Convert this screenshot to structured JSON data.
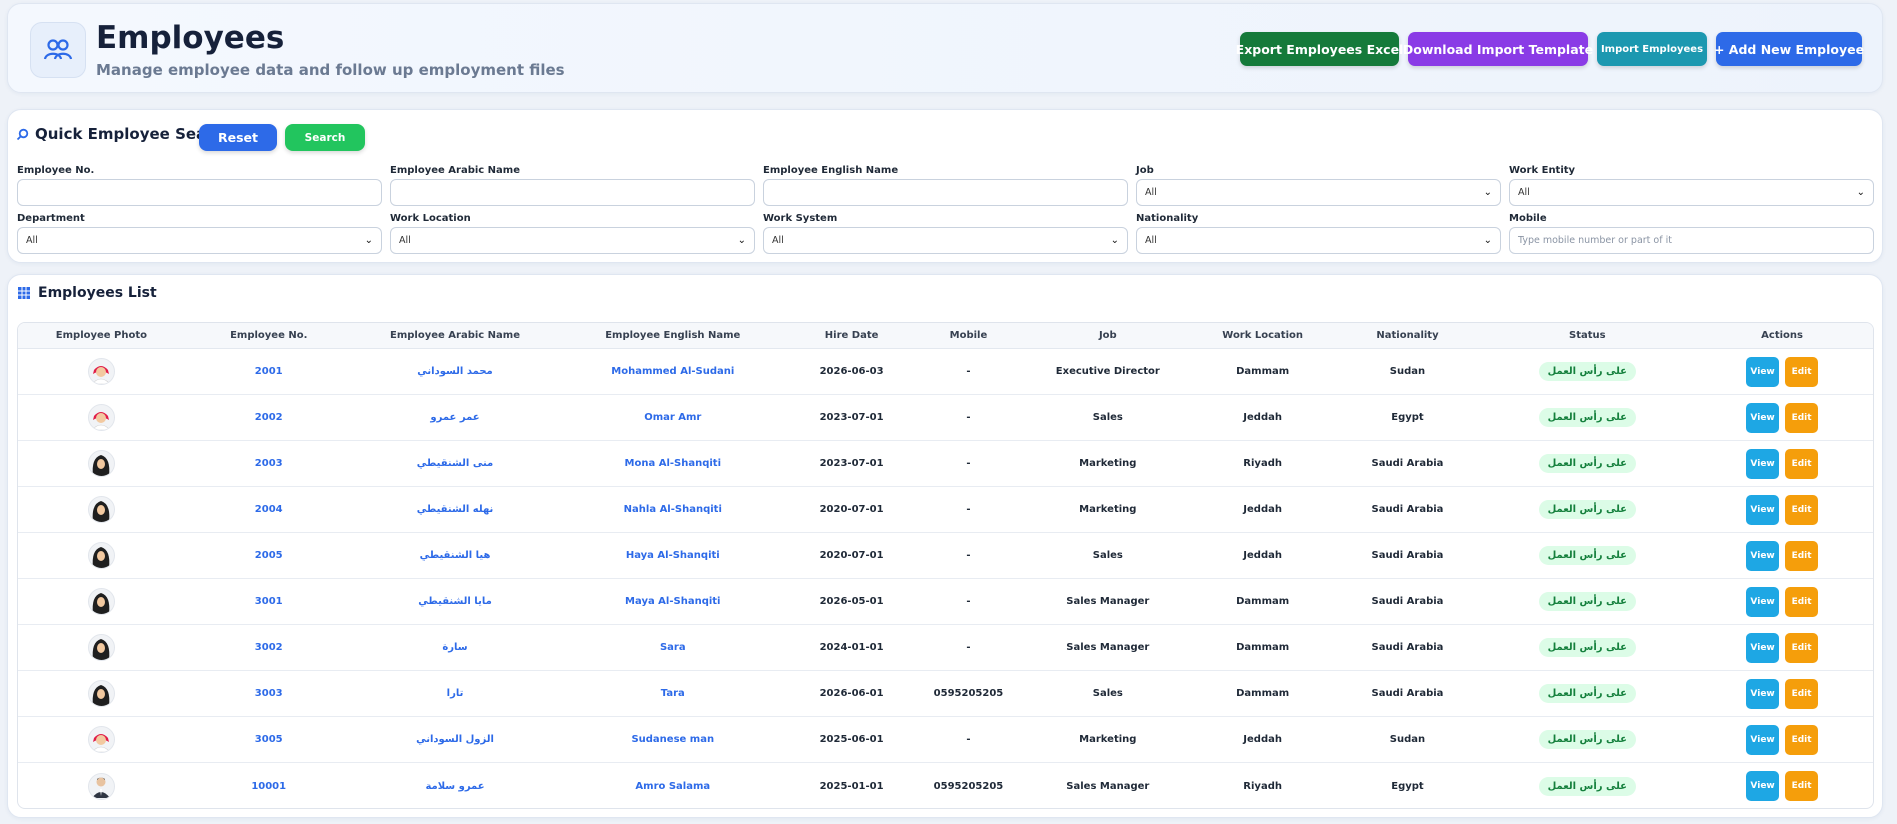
{
  "header": {
    "title": "Employees",
    "subtitle": "Manage employee data and follow up employment files",
    "icon": "users-icon",
    "buttons": {
      "export": "Export Employees Excel",
      "template": "Download Import Template",
      "import": "Import Employees",
      "add": "+ Add New Employee"
    }
  },
  "search": {
    "title": "Quick Employee Search",
    "reset_label": "Reset",
    "search_label": "Search",
    "fields": {
      "employee_no": {
        "label": "Employee No.",
        "value": ""
      },
      "arabic_name": {
        "label": "Employee Arabic Name",
        "value": ""
      },
      "english_name": {
        "label": "Employee English Name",
        "value": ""
      },
      "job": {
        "label": "Job",
        "value": "All"
      },
      "work_entity": {
        "label": "Work Entity",
        "value": "All"
      },
      "department": {
        "label": "Department",
        "value": "All"
      },
      "work_location": {
        "label": "Work Location",
        "value": "All"
      },
      "work_system": {
        "label": "Work System",
        "value": "All"
      },
      "nationality": {
        "label": "Nationality",
        "value": "All"
      },
      "mobile": {
        "label": "Mobile",
        "placeholder": "Type mobile number or part of it"
      }
    }
  },
  "list": {
    "title": "Employees List",
    "columns": [
      "Employee Photo",
      "Employee No.",
      "Employee Arabic Name",
      "Employee English Name",
      "Hire Date",
      "Mobile",
      "Job",
      "Work Location",
      "Nationality",
      "Status",
      "Actions"
    ],
    "view_label": "View",
    "edit_label": "Edit",
    "rows": [
      {
        "photo": "male",
        "no": "2001",
        "ar": "محمد السوداني",
        "en": "Mohammed Al-Sudani",
        "hire": "2026-06-03",
        "mobile": "-",
        "job": "Executive Director",
        "location": "Dammam",
        "nationality": "Sudan",
        "status": "على رأس العمل"
      },
      {
        "photo": "male",
        "no": "2002",
        "ar": "عمر عمرو",
        "en": "Omar Amr",
        "hire": "2023-07-01",
        "mobile": "-",
        "job": "Sales",
        "location": "Jeddah",
        "nationality": "Egypt",
        "status": "على رأس العمل"
      },
      {
        "photo": "female",
        "no": "2003",
        "ar": "منى الشنقيطي",
        "en": "Mona Al-Shanqiti",
        "hire": "2023-07-01",
        "mobile": "-",
        "job": "Marketing",
        "location": "Riyadh",
        "nationality": "Saudi Arabia",
        "status": "على رأس العمل"
      },
      {
        "photo": "female",
        "no": "2004",
        "ar": "نهله الشنقيطي",
        "en": "Nahla Al-Shanqiti",
        "hire": "2020-07-01",
        "mobile": "-",
        "job": "Marketing",
        "location": "Jeddah",
        "nationality": "Saudi Arabia",
        "status": "على رأس العمل"
      },
      {
        "photo": "female",
        "no": "2005",
        "ar": "هيا الشنقيطي",
        "en": "Haya Al-Shanqiti",
        "hire": "2020-07-01",
        "mobile": "-",
        "job": "Sales",
        "location": "Jeddah",
        "nationality": "Saudi Arabia",
        "status": "على رأس العمل"
      },
      {
        "photo": "female",
        "no": "3001",
        "ar": "مايا الشنقيطي",
        "en": "Maya Al-Shanqiti",
        "hire": "2026-05-01",
        "mobile": "-",
        "job": "Sales Manager",
        "location": "Dammam",
        "nationality": "Saudi Arabia",
        "status": "على رأس العمل"
      },
      {
        "photo": "female",
        "no": "3002",
        "ar": "سارة",
        "en": "Sara",
        "hire": "2024-01-01",
        "mobile": "-",
        "job": "Sales Manager",
        "location": "Dammam",
        "nationality": "Saudi Arabia",
        "status": "على رأس العمل"
      },
      {
        "photo": "female",
        "no": "3003",
        "ar": "تارا",
        "en": "Tara",
        "hire": "2026-06-01",
        "mobile": "0595205205",
        "job": "Sales",
        "location": "Dammam",
        "nationality": "Saudi Arabia",
        "status": "على رأس العمل"
      },
      {
        "photo": "male",
        "no": "3005",
        "ar": "الزول السوداني",
        "en": "Sudanese man",
        "hire": "2025-06-01",
        "mobile": "-",
        "job": "Marketing",
        "location": "Jeddah",
        "nationality": "Sudan",
        "status": "على رأس العمل"
      },
      {
        "photo": "suit",
        "no": "10001",
        "ar": "عمرو سلامة",
        "en": "Amro Salama",
        "hire": "2025-01-01",
        "mobile": "0595205205",
        "job": "Sales Manager",
        "location": "Riyadh",
        "nationality": "Egypt",
        "status": "على رأس العمل"
      }
    ]
  },
  "colors": {
    "accent": "#2d6ae8",
    "export": "#157a3a",
    "template": "#8a3be6",
    "import": "#1c98b0",
    "search": "#22c55e",
    "view": "#1ea7e4",
    "edit": "#f59e0b",
    "status_bg": "#dcfce7",
    "status_text": "#15803d"
  }
}
